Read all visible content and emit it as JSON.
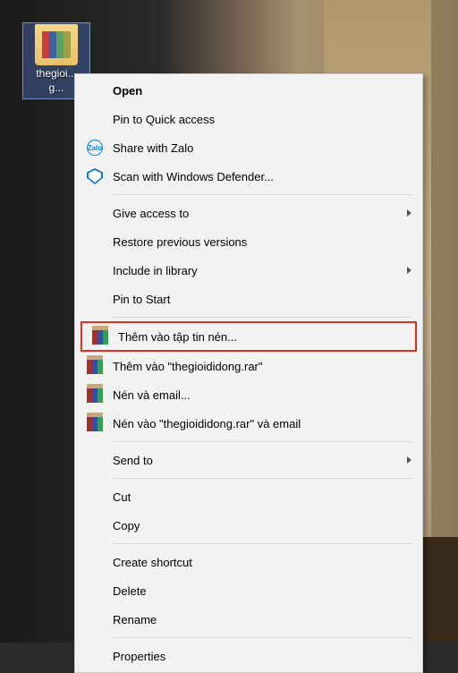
{
  "desktop": {
    "folder": {
      "label": "thegioi...\ng..."
    }
  },
  "menu": {
    "open": "Open",
    "pin_quick_access": "Pin to Quick access",
    "share_zalo": "Share with Zalo",
    "scan_defender": "Scan with Windows Defender...",
    "give_access": "Give access to",
    "restore_versions": "Restore previous versions",
    "include_library": "Include in library",
    "pin_start": "Pin to Start",
    "add_archive": "Thêm vào tập tin nén...",
    "add_named": "Thêm vào \"thegioididong.rar\"",
    "compress_email": "Nén và email...",
    "compress_named_email": "Nén vào \"thegioididong.rar\" và email",
    "send_to": "Send to",
    "cut": "Cut",
    "copy": "Copy",
    "create_shortcut": "Create shortcut",
    "delete": "Delete",
    "rename": "Rename",
    "properties": "Properties"
  }
}
